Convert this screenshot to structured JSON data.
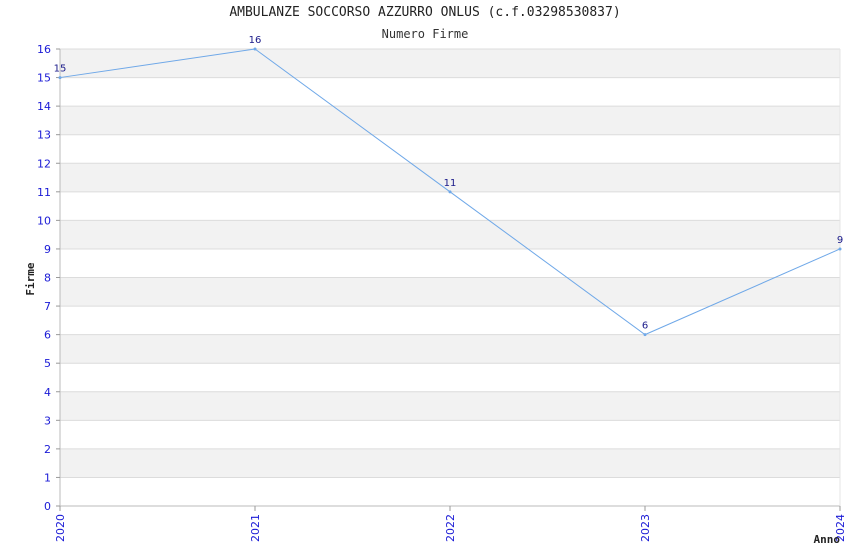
{
  "chart_data": {
    "type": "line",
    "title": "AMBULANZE SOCCORSO AZZURRO ONLUS (c.f.03298530837)",
    "subtitle": "Numero Firme",
    "xlabel": "Anno",
    "ylabel": "Firme",
    "categories": [
      "2020",
      "2021",
      "2022",
      "2023",
      "2024"
    ],
    "series": [
      {
        "values": [
          15,
          16,
          11,
          6,
          9
        ]
      }
    ],
    "ylim": [
      0,
      16
    ],
    "yticks": [
      "0",
      "1",
      "2",
      "3",
      "4",
      "5",
      "6",
      "7",
      "8",
      "9",
      "10",
      "11",
      "12",
      "13",
      "14",
      "15",
      "16"
    ],
    "grid": "horizontal",
    "band_colors": [
      "#ffffff",
      "#f2f2f2"
    ],
    "line_color": "#6fa8e8",
    "tick_color": "#1a1ad6"
  }
}
